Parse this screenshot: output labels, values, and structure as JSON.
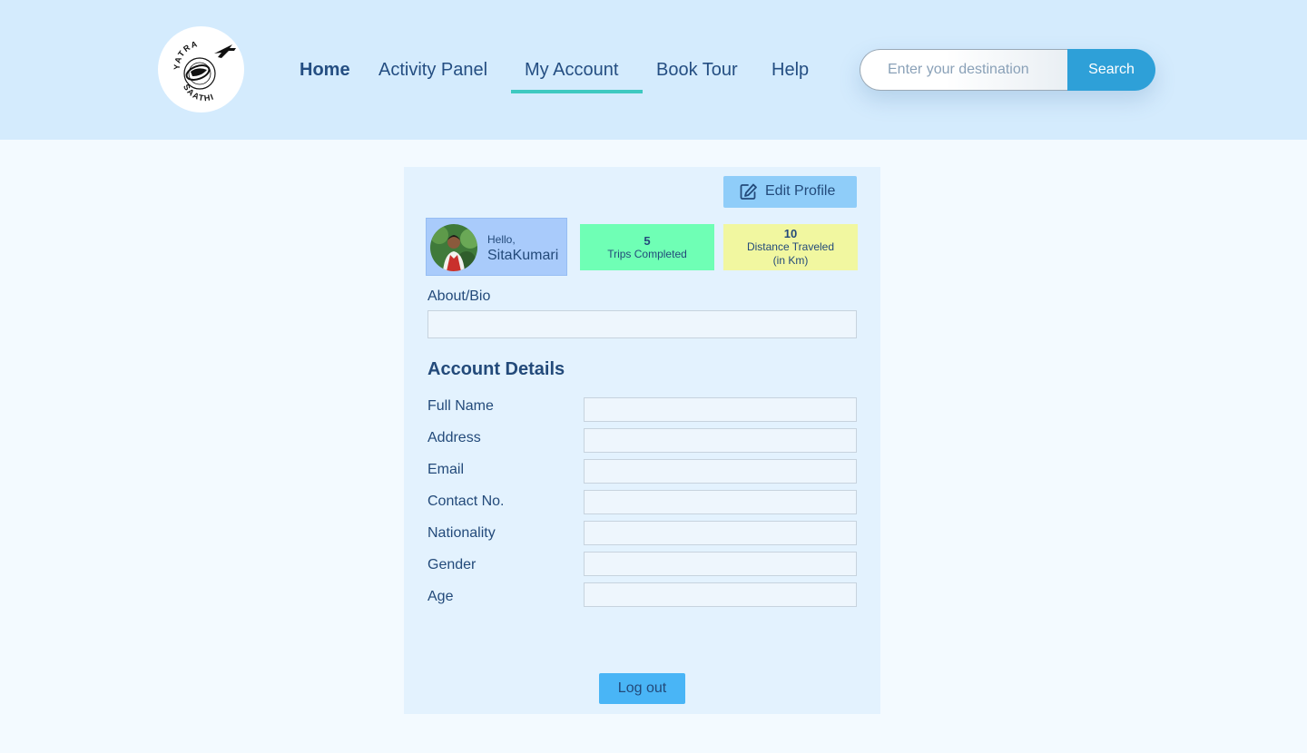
{
  "brand": {
    "logo_text_top": "YATRA",
    "logo_text_bottom": "SAATHI"
  },
  "nav": {
    "items": [
      {
        "label": "Home"
      },
      {
        "label": "Activity Panel"
      },
      {
        "label": "My Account",
        "active": true
      },
      {
        "label": "Book Tour"
      },
      {
        "label": "Help"
      }
    ]
  },
  "search": {
    "placeholder": "Enter your destination",
    "value": "",
    "button_label": "Search"
  },
  "profile": {
    "edit_label": "Edit Profile",
    "greeting": "Hello,",
    "name": "SitaKumari",
    "stats": {
      "trips": {
        "value": "5",
        "label": "Trips Completed"
      },
      "distance": {
        "value": "10",
        "label": "Distance Traveled",
        "unit": "(in Km)"
      }
    },
    "bio_label": "About/Bio",
    "bio_value": ""
  },
  "account": {
    "title": "Account Details",
    "fields": [
      {
        "label": "Full Name",
        "value": ""
      },
      {
        "label": "Address",
        "value": ""
      },
      {
        "label": "Email",
        "value": ""
      },
      {
        "label": "Contact No.",
        "value": ""
      },
      {
        "label": "Nationality",
        "value": ""
      },
      {
        "label": "Gender",
        "value": ""
      },
      {
        "label": "Age",
        "value": ""
      }
    ]
  },
  "logout_label": "Log out",
  "colors": {
    "header_bg": "#d4ebfd",
    "active_underline": "#3ec9c0",
    "search_button": "#2ea0d8",
    "trips_bg": "#6fffb5",
    "distance_bg": "#f1f7a0",
    "logout_bg": "#49b5f6"
  }
}
